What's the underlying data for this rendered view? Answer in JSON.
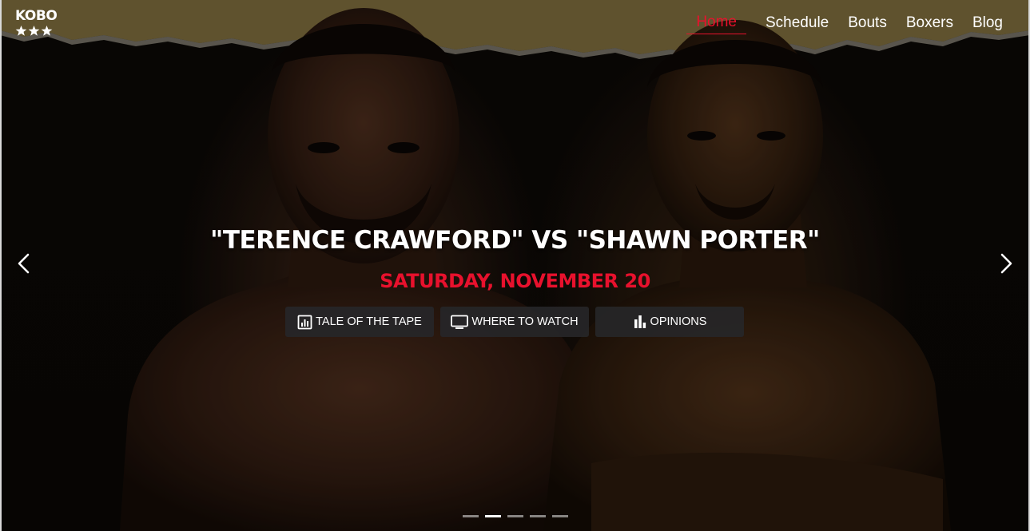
{
  "logo": {
    "text": "KOBO",
    "stars": 3
  },
  "nav": {
    "items": [
      {
        "label": "Home",
        "active": true
      },
      {
        "label": "Schedule",
        "active": false
      },
      {
        "label": "Bouts",
        "active": false
      },
      {
        "label": "Boxers",
        "active": false
      },
      {
        "label": "Blog",
        "active": false
      }
    ]
  },
  "hero": {
    "title": "\"TERENCE CRAWFORD\" VS \"SHAWN PORTER\"",
    "date": "SATURDAY, NOVEMBER 20",
    "buttons": [
      {
        "label": "TALE OF THE TAPE",
        "icon": "chart-box-icon"
      },
      {
        "label": "WHERE TO WATCH",
        "icon": "monitor-icon"
      },
      {
        "label": "OPINIONS",
        "icon": "bar-chart-icon"
      }
    ]
  },
  "carousel": {
    "slide_count": 5,
    "active_index": 1
  },
  "colors": {
    "accent": "#e8112d",
    "button_bg": "#262628",
    "strip": "#7a6a3c"
  }
}
